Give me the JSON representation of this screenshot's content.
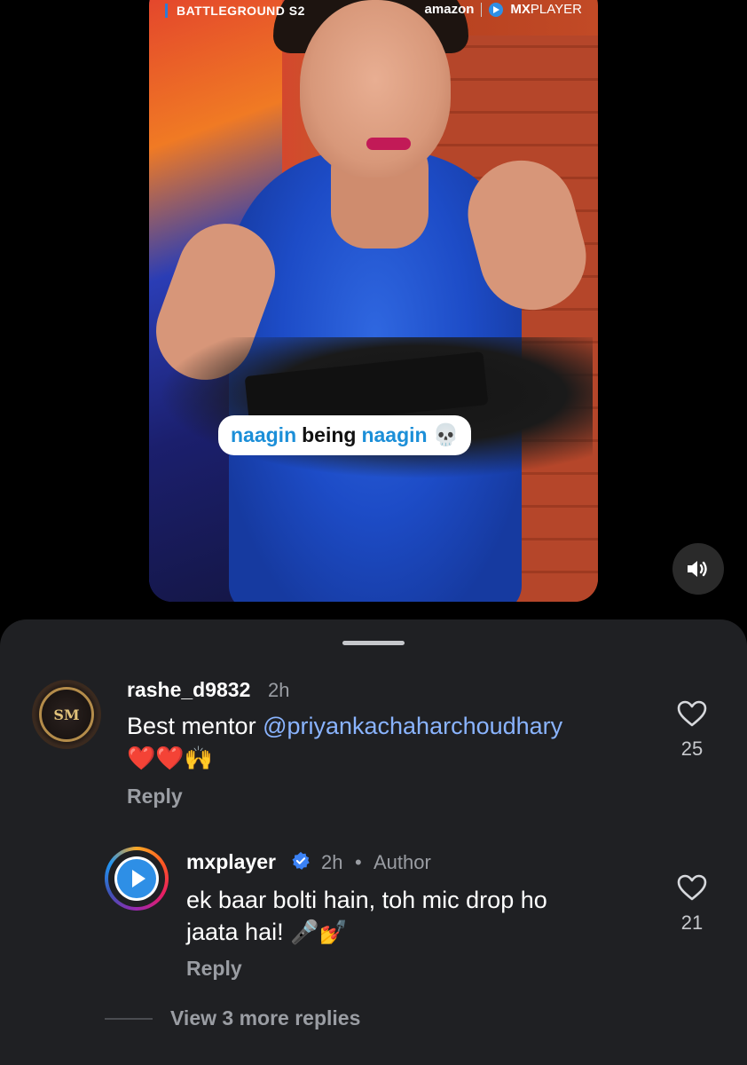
{
  "video": {
    "show_title": "BATTLEGROUND S2",
    "brand_amazon": "amazon",
    "brand_mx_bold": "MX",
    "brand_mx_rest": "PLAYER",
    "caption_word1": "naagin",
    "caption_word2": "being",
    "caption_word3": "naagin",
    "caption_emoji": "💀",
    "mute_icon": "speaker-volume-icon"
  },
  "comments": [
    {
      "username": "rashe_d9832",
      "time": "2h",
      "avatar_text": "SM",
      "text_prefix": "Best mentor ",
      "mention": "@priyankachaharchoudhary",
      "emojis": "❤️❤️🙌",
      "reply_label": "Reply",
      "likes": "25"
    },
    {
      "username": "mxplayer",
      "time": "2h",
      "separator": "•",
      "author_label": "Author",
      "text_line1": "ek baar bolti hain, toh mic drop ho",
      "text_line2": "jaata hai! ",
      "emojis": "🎤💅",
      "reply_label": "Reply",
      "likes": "21"
    }
  ],
  "view_more": "View 3 more replies",
  "colors": {
    "sheet_bg": "#1f2023",
    "mention": "#8ab4ff",
    "caption_blue": "#1c8fd8",
    "verified_blue": "#3b82f6"
  }
}
